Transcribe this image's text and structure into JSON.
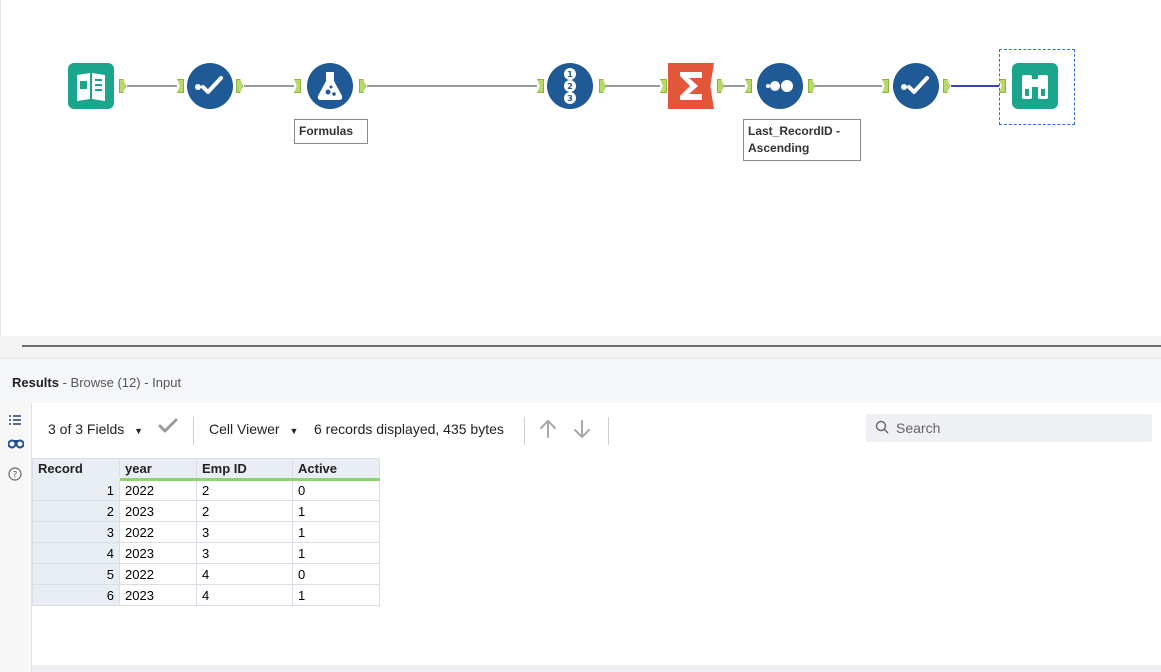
{
  "workflow": {
    "tools": [
      {
        "id": "input",
        "icon": "input-data-book-icon",
        "color": "#1aa58c"
      },
      {
        "id": "select1",
        "icon": "select-check-icon",
        "color": "#1f5a96"
      },
      {
        "id": "formula",
        "icon": "formula-flask-icon",
        "color": "#1f5a96"
      },
      {
        "id": "recordid",
        "icon": "record-id-123-icon",
        "color": "#1f5a96"
      },
      {
        "id": "summarize",
        "icon": "summarize-sigma-icon",
        "color": "#e2563a"
      },
      {
        "id": "sample",
        "icon": "sample-dots-icon",
        "color": "#1f5a96"
      },
      {
        "id": "select2",
        "icon": "select-check-icon",
        "color": "#1f5a96"
      },
      {
        "id": "browse",
        "icon": "browse-binoculars-icon",
        "color": "#1aa58c"
      }
    ],
    "labels": {
      "formula": "Formulas",
      "sample_line1": "Last_RecordID -",
      "sample_line2": "Ascending"
    }
  },
  "results": {
    "title": "Results",
    "subtitle": " - Browse (12) - Input"
  },
  "toolbar": {
    "fields": "3 of 3 Fields",
    "cell_viewer": "Cell Viewer",
    "records_info": "6 records displayed, 435 bytes",
    "search_placeholder": "Search"
  },
  "grid": {
    "headers": [
      "Record",
      "year",
      "Emp ID",
      "Active"
    ],
    "rows": [
      [
        "1",
        "2022",
        "2",
        "0"
      ],
      [
        "2",
        "2023",
        "2",
        "1"
      ],
      [
        "3",
        "2022",
        "3",
        "1"
      ],
      [
        "4",
        "2023",
        "3",
        "1"
      ],
      [
        "5",
        "2022",
        "4",
        "0"
      ],
      [
        "6",
        "2023",
        "4",
        "1"
      ]
    ]
  },
  "colors": {
    "tool_blue": "#1f5a96",
    "tool_teal": "#1aa58c",
    "tool_orange": "#e2563a",
    "anchor_green": "#b6d96a",
    "header_underline": "#8fd46b"
  }
}
